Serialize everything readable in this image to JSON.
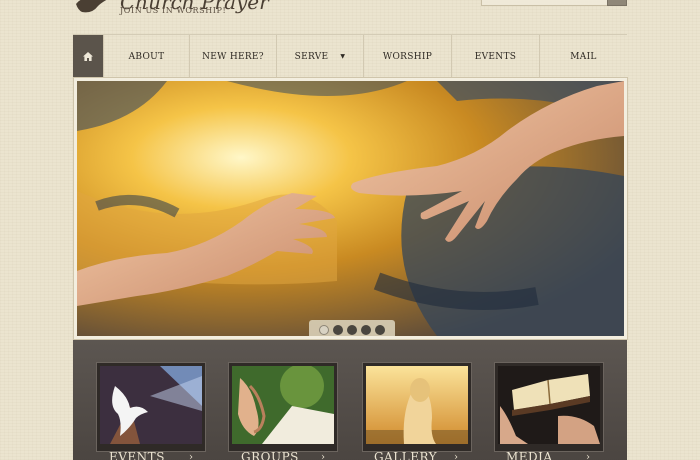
{
  "header": {
    "logo_title": "Church Prayer",
    "tagline": "JOIN US IN WORSHIP!",
    "search_placeholder": ""
  },
  "nav": {
    "items": [
      {
        "label": "ABOUT"
      },
      {
        "label": "NEW HERE?"
      },
      {
        "label": "SERVE"
      },
      {
        "label": "WORSHIP"
      },
      {
        "label": "EVENTS"
      },
      {
        "label": "MAIL"
      }
    ],
    "serve_caret": "▼"
  },
  "slider": {
    "slide_count": 5,
    "active_index": 0
  },
  "cards": [
    {
      "label": "EVENTS",
      "arrow": "›"
    },
    {
      "label": "GROUPS",
      "arrow": "›"
    },
    {
      "label": "GALLERY",
      "arrow": "›"
    },
    {
      "label": "MEDIA",
      "arrow": "›"
    }
  ],
  "colors": {
    "background": "#ebe4cf",
    "nav_home": "#5b544b",
    "panel": "#524c47"
  }
}
